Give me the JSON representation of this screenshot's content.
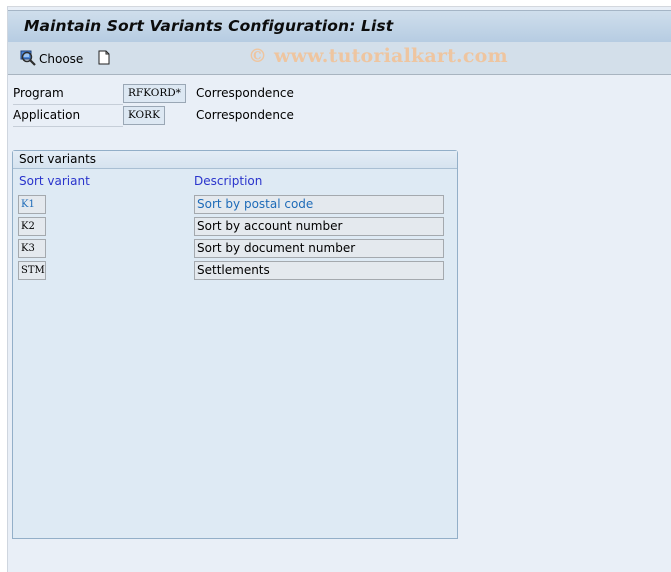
{
  "window": {
    "title": "Maintain Sort Variants Configuration: List"
  },
  "toolbar": {
    "choose_label": "Choose",
    "choose_icon": "choose-magnifier-icon",
    "new_icon": "new-document-icon"
  },
  "watermark": "© www.tutorialkart.com",
  "fields": [
    {
      "label": "Program",
      "value": "RFKORD*",
      "description": "Correspondence"
    },
    {
      "label": "Application",
      "value": "KORK",
      "description": "Correspondence"
    }
  ],
  "sort_group": {
    "title": "Sort variants",
    "columns": [
      "Sort variant",
      "Description"
    ],
    "rows": [
      {
        "variant": "K1",
        "description": "Sort by postal code",
        "highlighted": true
      },
      {
        "variant": "K2",
        "description": "Sort by account number",
        "highlighted": false
      },
      {
        "variant": "K3",
        "description": "Sort by document number",
        "highlighted": false
      },
      {
        "variant": "STM",
        "description": "Settlements",
        "highlighted": false
      }
    ]
  },
  "colors": {
    "title_bar": "#b6cce2",
    "toolbar": "#d3dfea",
    "background": "#e9eff7",
    "column_header_text": "#2a34cc",
    "highlight_text": "#1e6bb8",
    "watermark": "#f1c399"
  }
}
